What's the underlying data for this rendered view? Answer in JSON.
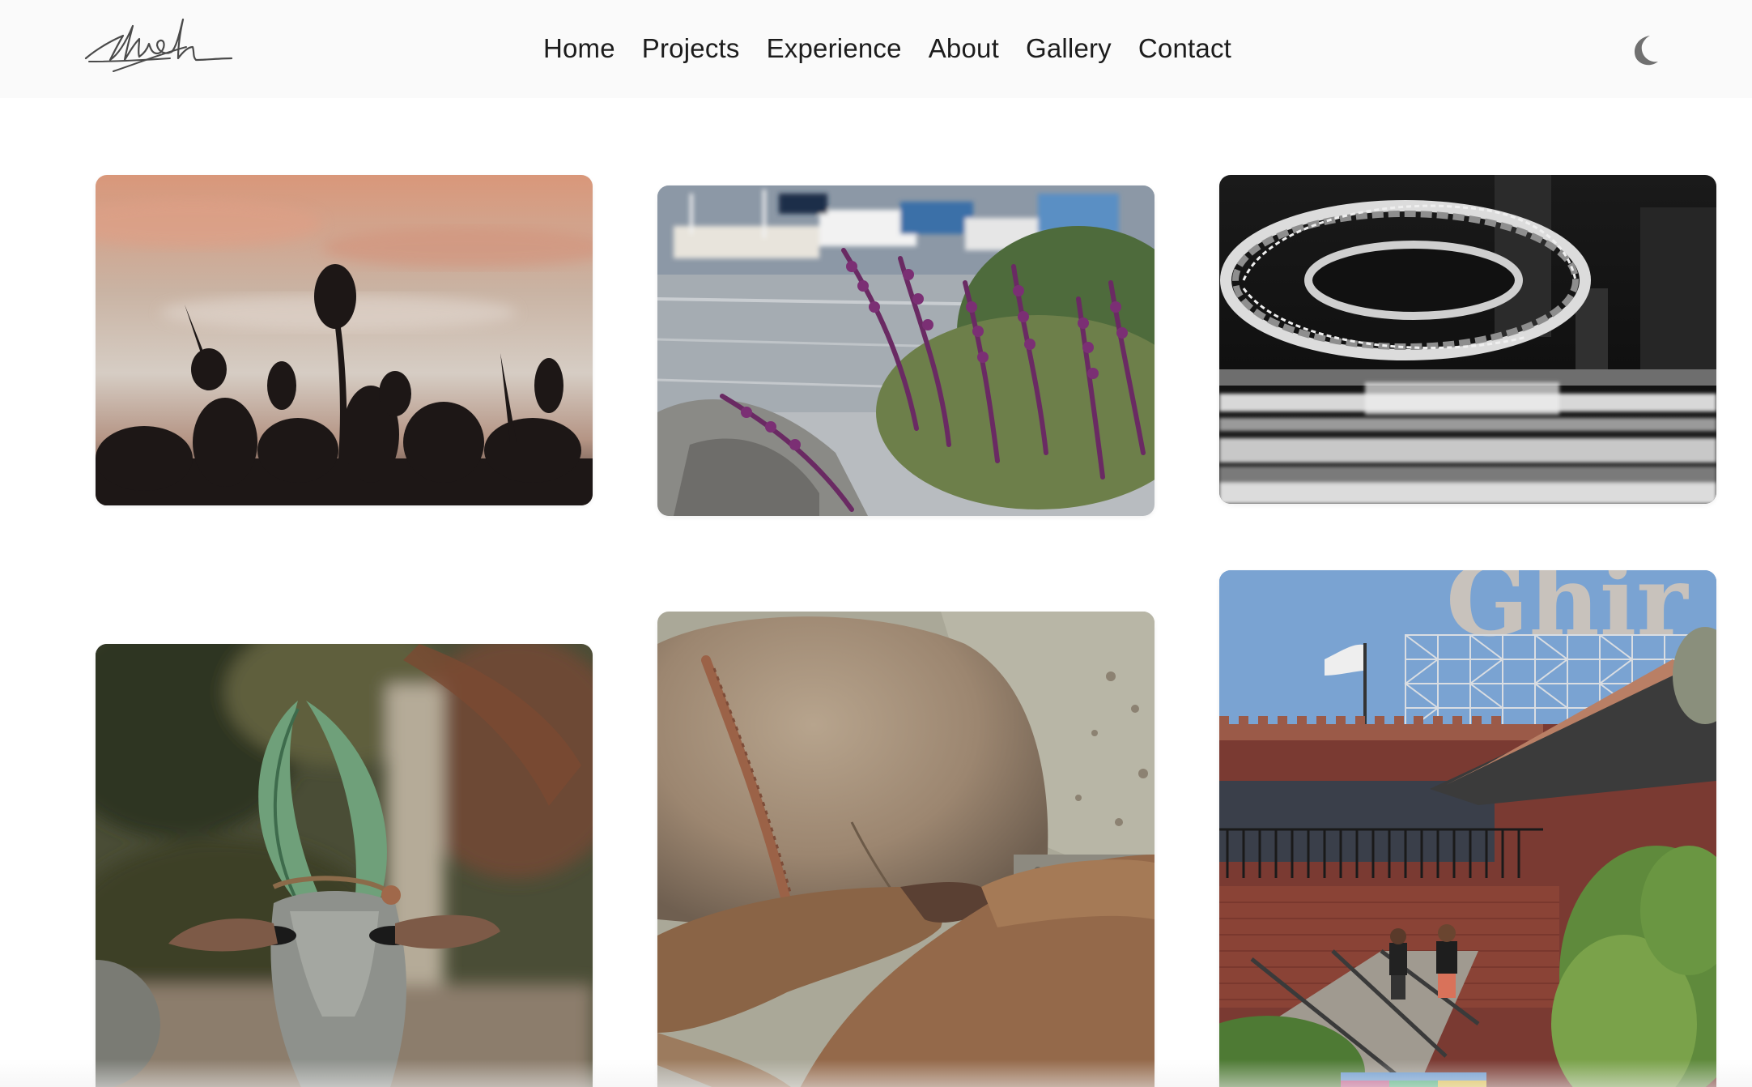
{
  "nav": {
    "logo_alt": "signature logo",
    "links": [
      {
        "label": "Home"
      },
      {
        "label": "Projects"
      },
      {
        "label": "Experience"
      },
      {
        "label": "About"
      },
      {
        "label": "Gallery"
      },
      {
        "label": "Contact"
      }
    ],
    "theme_icon": "moon-icon"
  },
  "gallery": {
    "photos": [
      {
        "subject": "silhouette plants at sunset"
      },
      {
        "subject": "purple flowers by marina"
      },
      {
        "subject": "museum of the future black and white"
      },
      {
        "subject": "bull with green horns"
      },
      {
        "subject": "sea lions on rock"
      },
      {
        "subject": "ghirardelli square building"
      }
    ]
  },
  "colors": {
    "nav_bg": "#fafafa",
    "text": "#1c1c1c",
    "moon": "#707070"
  }
}
